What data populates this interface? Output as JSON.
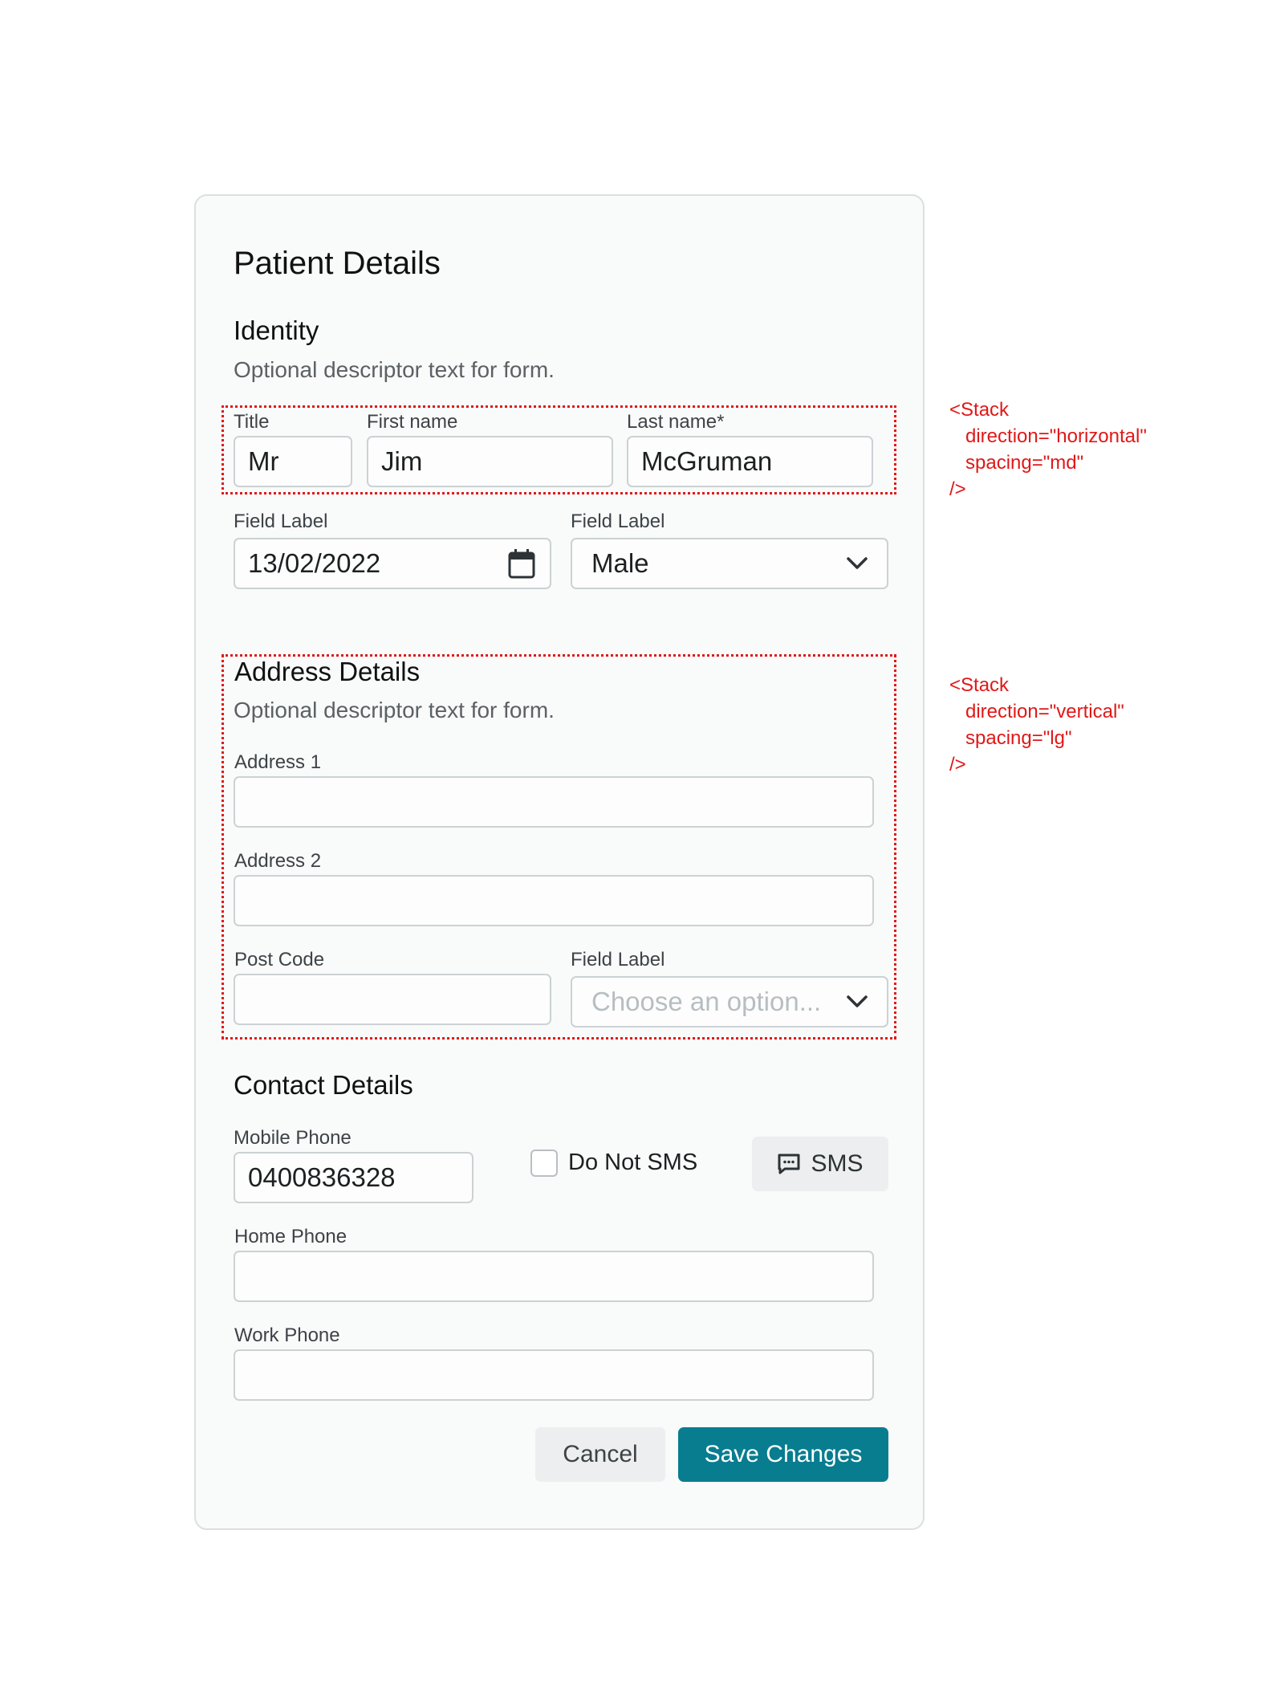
{
  "form": {
    "title": "Patient Details",
    "identity": {
      "title": "Identity",
      "description": "Optional descriptor text for form.",
      "title_field": {
        "label": "Title",
        "value": "Mr"
      },
      "first_name": {
        "label": "First name",
        "value": "Jim"
      },
      "last_name": {
        "label": "Last name*",
        "value": "McGruman"
      },
      "dob": {
        "label": "Field Label",
        "value": "13/02/2022",
        "icon": "calendar-icon"
      },
      "gender": {
        "label": "Field Label",
        "value": "Male",
        "icon": "chevron-down-icon"
      }
    },
    "address": {
      "title": "Address Details",
      "description": "Optional descriptor text for form.",
      "address1": {
        "label": "Address 1",
        "value": ""
      },
      "address2": {
        "label": "Address 2",
        "value": ""
      },
      "postcode": {
        "label": "Post Code",
        "value": ""
      },
      "select": {
        "label": "Field Label",
        "placeholder": "Choose an option...",
        "icon": "chevron-down-icon"
      }
    },
    "contact": {
      "title": "Contact Details",
      "mobile": {
        "label": "Mobile Phone",
        "value": "0400836328"
      },
      "do_not_sms": {
        "label": "Do Not SMS",
        "checked": false
      },
      "sms_button": {
        "label": "SMS",
        "icon": "message-icon"
      },
      "home_phone": {
        "label": "Home Phone",
        "value": ""
      },
      "work_phone": {
        "label": "Work Phone",
        "value": ""
      }
    },
    "actions": {
      "cancel": "Cancel",
      "save": "Save Changes"
    }
  },
  "annotations": {
    "horizontal_stack": "<Stack\n   direction=\"horizontal\"\n   spacing=\"md\"\n/>",
    "vertical_stack": "<Stack\n   direction=\"vertical\"\n   spacing=\"lg\"\n/>"
  },
  "colors": {
    "accent": "#087d8f",
    "annotation": "#e01818",
    "border": "#ccd2d4",
    "card_background": "#f9fafa"
  }
}
